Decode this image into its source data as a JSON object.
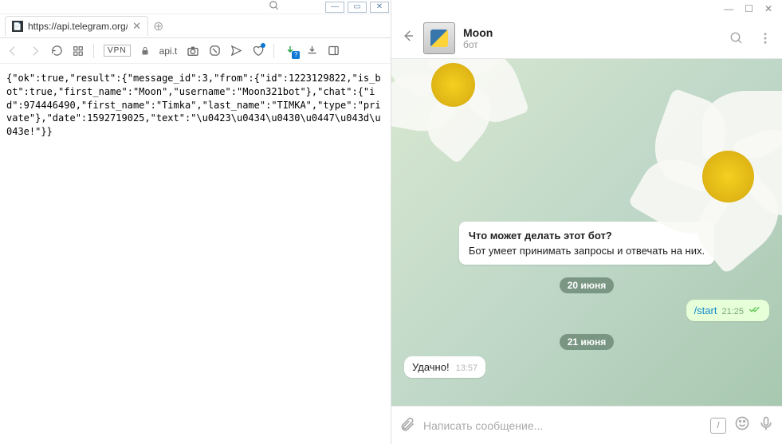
{
  "browser": {
    "tab_title": "https://api.telegram.org/bo",
    "address": "api.t",
    "vpn_label": "VPN",
    "json_text": "{\"ok\":true,\"result\":{\"message_id\":3,\"from\":{\"id\":1223129822,\"is_bot\":true,\"first_name\":\"Moon\",\"username\":\"Moon321bot\"},\"chat\":{\"id\":974446490,\"first_name\":\"Timka\",\"last_name\":\"TIMKA\",\"type\":\"private\"},\"date\":1592719025,\"text\":\"\\u0423\\u0434\\u0430\\u0447\\u043d\\u043e!\"}}"
  },
  "telegram": {
    "chat_name": "Moon",
    "chat_sub": "бот",
    "bot_card": {
      "title": "Что может делать этот бот?",
      "body": "Бот умеет принимать запросы и отвечать на них."
    },
    "dates": {
      "d1": "20 июня",
      "d2": "21 июня"
    },
    "msg_out": {
      "text": "/start",
      "time": "21:25"
    },
    "msg_in": {
      "text": "Удачно!",
      "time": "13:57"
    },
    "input_placeholder": "Написать сообщение..."
  }
}
